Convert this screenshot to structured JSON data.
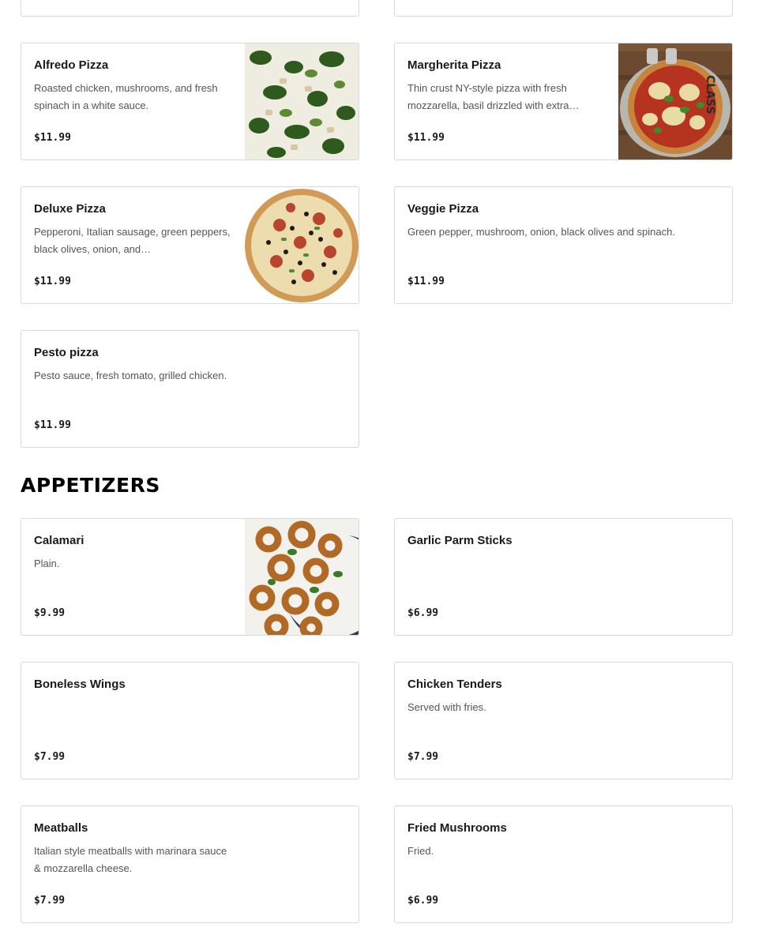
{
  "pizza": {
    "partial_left": {
      "price": "$"
    },
    "partial_right": {
      "price": "$"
    },
    "items": [
      {
        "name": "Alfredo Pizza",
        "description": "Roasted chicken, mushrooms, and fresh spinach in a white sauce.",
        "price": "$11.99",
        "image": "alfredo-pizza-photo"
      },
      {
        "name": "Margherita Pizza",
        "description": "Thin crust NY-style pizza with fresh mozzarella, basil drizzled with extra…",
        "price": "$11.99",
        "image": "margherita-pizza-photo"
      },
      {
        "name": "Deluxe Pizza",
        "description": "Pepperoni, Italian sausage, green peppers, black olives, onion, and…",
        "price": "$11.99",
        "image": "deluxe-pizza-photo"
      },
      {
        "name": "Veggie Pizza",
        "description": "Green pepper, mushroom, onion, black olives and spinach.",
        "price": "$11.99"
      },
      {
        "name": "Pesto pizza",
        "description": "Pesto sauce, fresh tomato, grilled chicken.",
        "price": "$11.99"
      }
    ]
  },
  "appetizers": {
    "title": "APPETIZERS",
    "items": [
      {
        "name": "Calamari",
        "description": "Plain.",
        "price": "$9.99",
        "image": "calamari-photo"
      },
      {
        "name": "Garlic Parm Sticks",
        "description": "",
        "price": "$6.99"
      },
      {
        "name": "Boneless Wings",
        "description": "",
        "price": "$7.99"
      },
      {
        "name": "Chicken Tenders",
        "description": "Served with fries.",
        "price": "$7.99"
      },
      {
        "name": "Meatballs",
        "description": "Italian style meatballs with marinara sauce & mozzarella cheese.",
        "price": "$7.99"
      },
      {
        "name": "Fried Mushrooms",
        "description": "Fried.",
        "price": "$6.99"
      }
    ]
  }
}
